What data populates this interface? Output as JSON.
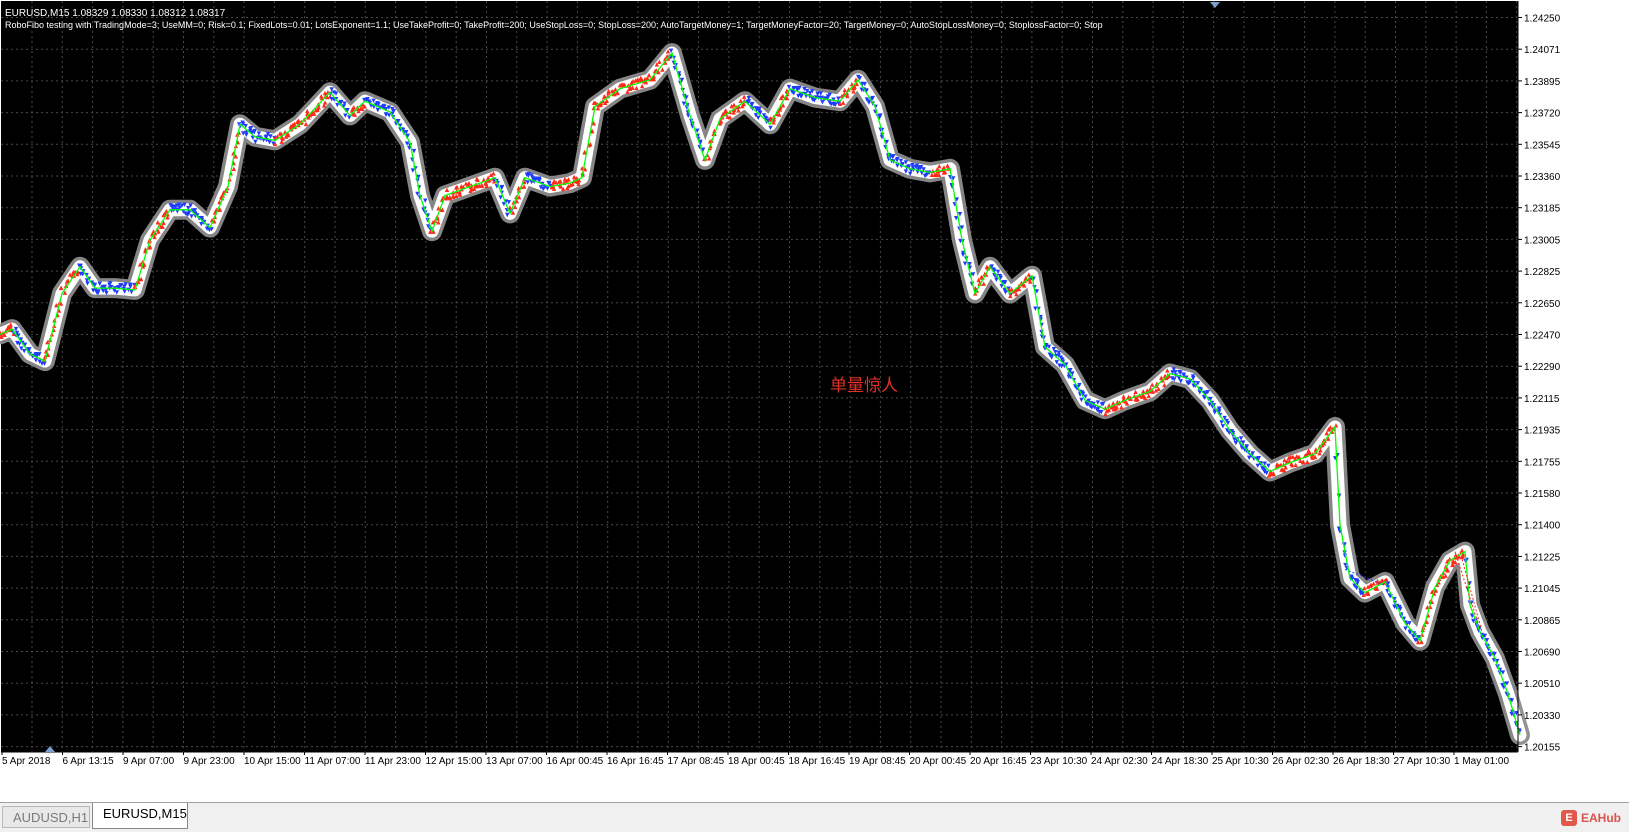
{
  "chart_header": {
    "symbol_line": "EURUSD,M15  1.08329 1.08330 1.08312 1.08317",
    "ea_params": "RoboFibo testing with TradingMode=3; UseMM=0; Risk=0.1; FixedLots=0.01; LotsExponent=1.1; UseTakeProfit=0; TakeProfit=200; UseStopLoss=0; StopLoss=200; AutoTargetMoney=1; TargetMoneyFactor=20; TargetMoney=0; AutoStopLossMoney=0; StoplossFactor=0; Stop"
  },
  "watermark_text": "单量惊人",
  "tabs": [
    {
      "label": "AUDUSD,H1",
      "active": false
    },
    {
      "label": "EURUSD,M15",
      "active": true
    }
  ],
  "logo_text": "EAHub",
  "colors": {
    "background": "#000000",
    "grid": "#4a4a4a",
    "axis_text": "#ffffff",
    "buy": "#1e3cff",
    "sell": "#ff2a1a",
    "price": "#00ff00",
    "band": "#8c8c8c",
    "watermark": "#e0302a"
  },
  "chart_data": {
    "type": "line",
    "title": "",
    "xlabel": "",
    "ylabel": "",
    "ylim": [
      1.20105,
      1.24305
    ],
    "y_ticks": [
      "1.24250",
      "1.24071",
      "1.23895",
      "1.23720",
      "1.23545",
      "1.23360",
      "1.23185",
      "1.23005",
      "1.22825",
      "1.22650",
      "1.22470",
      "1.22290",
      "1.22115",
      "1.21935",
      "1.21755",
      "1.21580",
      "1.21400",
      "1.21225",
      "1.21045",
      "1.20865",
      "1.20690",
      "1.20510",
      "1.20330",
      "1.20155"
    ],
    "x_ticks": [
      "5 Apr 2018",
      "6 Apr 13:15",
      "9 Apr 07:00",
      "9 Apr 23:00",
      "10 Apr 15:00",
      "11 Apr 07:00",
      "11 Apr 23:00",
      "12 Apr 15:00",
      "13 Apr 07:00",
      "16 Apr 00:45",
      "16 Apr 16:45",
      "17 Apr 08:45",
      "18 Apr 00:45",
      "18 Apr 16:45",
      "19 Apr 08:45",
      "20 Apr 00:45",
      "20 Apr 16:45",
      "23 Apr 10:30",
      "24 Apr 02:30",
      "24 Apr 18:30",
      "25 Apr 10:30",
      "26 Apr 02:30",
      "26 Apr 18:30",
      "27 Apr 10:30",
      "1 May 01:00"
    ],
    "price_path": [
      [
        0,
        1.2247
      ],
      [
        12,
        1.225
      ],
      [
        30,
        1.2236
      ],
      [
        45,
        1.2232
      ],
      [
        62,
        1.227
      ],
      [
        80,
        1.2285
      ],
      [
        95,
        1.2273
      ],
      [
        115,
        1.2273
      ],
      [
        135,
        1.2272
      ],
      [
        150,
        1.23
      ],
      [
        170,
        1.2317
      ],
      [
        190,
        1.2317
      ],
      [
        210,
        1.2307
      ],
      [
        228,
        1.233
      ],
      [
        240,
        1.2365
      ],
      [
        255,
        1.2358
      ],
      [
        275,
        1.2356
      ],
      [
        300,
        1.2365
      ],
      [
        330,
        1.2383
      ],
      [
        350,
        1.237
      ],
      [
        365,
        1.2378
      ],
      [
        390,
        1.2372
      ],
      [
        410,
        1.2355
      ],
      [
        420,
        1.2325
      ],
      [
        432,
        1.2305
      ],
      [
        445,
        1.2325
      ],
      [
        470,
        1.233
      ],
      [
        495,
        1.2335
      ],
      [
        510,
        1.2315
      ],
      [
        525,
        1.2335
      ],
      [
        550,
        1.233
      ],
      [
        570,
        1.2332
      ],
      [
        582,
        1.2335
      ],
      [
        595,
        1.2375
      ],
      [
        620,
        1.2385
      ],
      [
        650,
        1.239
      ],
      [
        672,
        1.2405
      ],
      [
        690,
        1.237
      ],
      [
        705,
        1.2345
      ],
      [
        720,
        1.2368
      ],
      [
        745,
        1.2378
      ],
      [
        770,
        1.2365
      ],
      [
        790,
        1.2385
      ],
      [
        815,
        1.238
      ],
      [
        840,
        1.2378
      ],
      [
        858,
        1.239
      ],
      [
        875,
        1.2375
      ],
      [
        890,
        1.2345
      ],
      [
        910,
        1.234
      ],
      [
        930,
        1.2338
      ],
      [
        950,
        1.234
      ],
      [
        962,
        1.23
      ],
      [
        975,
        1.227
      ],
      [
        990,
        1.2285
      ],
      [
        1010,
        1.227
      ],
      [
        1032,
        1.228
      ],
      [
        1045,
        1.224
      ],
      [
        1065,
        1.223
      ],
      [
        1085,
        1.221
      ],
      [
        1105,
        1.2205
      ],
      [
        1125,
        1.221
      ],
      [
        1150,
        1.2215
      ],
      [
        1170,
        1.2225
      ],
      [
        1190,
        1.2222
      ],
      [
        1210,
        1.221
      ],
      [
        1230,
        1.2193
      ],
      [
        1250,
        1.218
      ],
      [
        1270,
        1.217
      ],
      [
        1290,
        1.2175
      ],
      [
        1315,
        1.218
      ],
      [
        1335,
        1.2195
      ],
      [
        1340,
        1.214
      ],
      [
        1350,
        1.211
      ],
      [
        1365,
        1.2102
      ],
      [
        1385,
        1.2108
      ],
      [
        1405,
        1.2085
      ],
      [
        1420,
        1.2075
      ],
      [
        1435,
        1.2105
      ],
      [
        1450,
        1.212
      ],
      [
        1465,
        1.2125
      ],
      [
        1470,
        1.2095
      ],
      [
        1480,
        1.208
      ],
      [
        1495,
        1.2065
      ],
      [
        1508,
        1.2045
      ],
      [
        1520,
        1.2022
      ]
    ],
    "orders": [
      {
        "type": "buy",
        "x_ticks_note": "dense blue arrows"
      },
      {
        "type": "sell",
        "x_ticks_note": "dense red arrows"
      }
    ],
    "grid": true
  }
}
